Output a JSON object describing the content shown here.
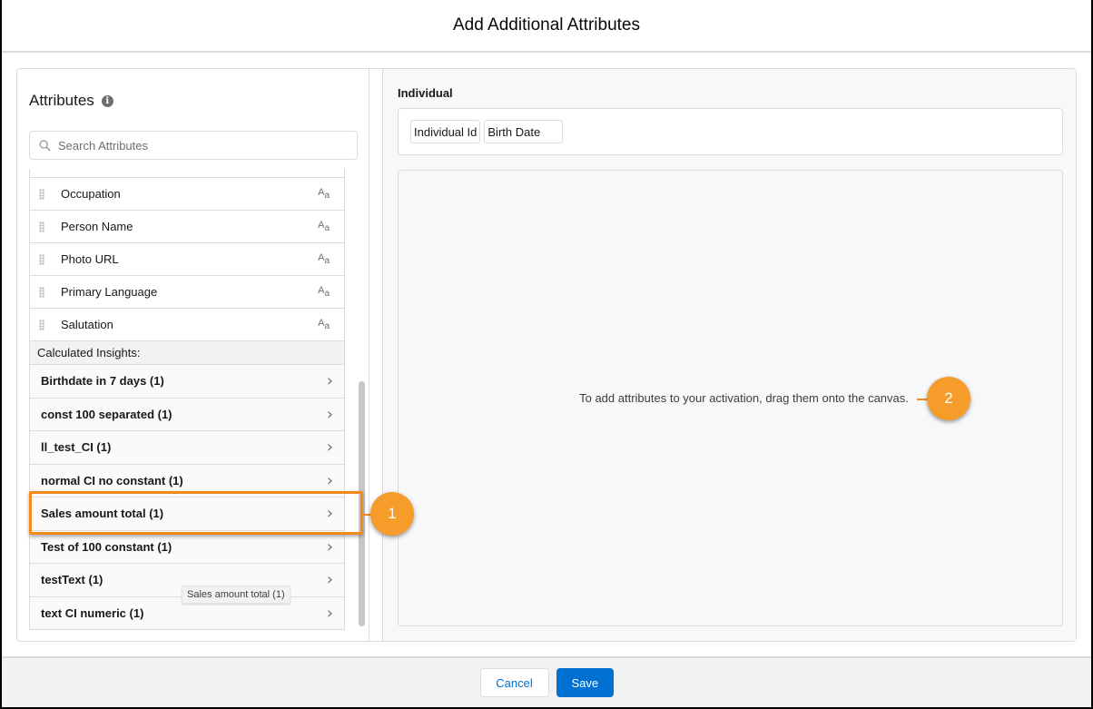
{
  "modal": {
    "title": "Add Additional Attributes"
  },
  "attributes_panel": {
    "title": "Attributes",
    "search_placeholder": "Search Attributes",
    "search_value": "",
    "attributes": [
      {
        "label": "Occupation",
        "type_icon": "text-type-icon"
      },
      {
        "label": "Person Name",
        "type_icon": "text-type-icon"
      },
      {
        "label": "Photo URL",
        "type_icon": "text-type-icon"
      },
      {
        "label": "Primary Language",
        "type_icon": "text-type-icon"
      },
      {
        "label": "Salutation",
        "type_icon": "text-type-icon"
      }
    ],
    "type_icon_glyph_big": "A",
    "type_icon_glyph_small": "a",
    "calculated_insights_heading": "Calculated Insights:",
    "calculated_insights": [
      {
        "label": "Birthdate in 7 days (1)"
      },
      {
        "label": "const 100 separated (1)"
      },
      {
        "label": "ll_test_CI (1)"
      },
      {
        "label": "normal CI no constant (1)"
      },
      {
        "label": "Sales amount total (1)",
        "highlighted": true
      },
      {
        "label": "Test of 100 constant (1)"
      },
      {
        "label": "testText (1)"
      },
      {
        "label": "text CI numeric (1)"
      }
    ],
    "tooltip": "Sales amount total (1)"
  },
  "canvas_panel": {
    "object_title": "Individual",
    "selected_attributes": [
      "Individual Id",
      "Birth Date"
    ],
    "empty_message": "To add attributes to your activation, drag them onto the canvas."
  },
  "callouts": {
    "one": "1",
    "two": "2",
    "color": "#f28b1b"
  },
  "footer": {
    "cancel_label": "Cancel",
    "save_label": "Save"
  },
  "colors": {
    "brand": "#0070d2",
    "callout": "#f59c2a"
  }
}
